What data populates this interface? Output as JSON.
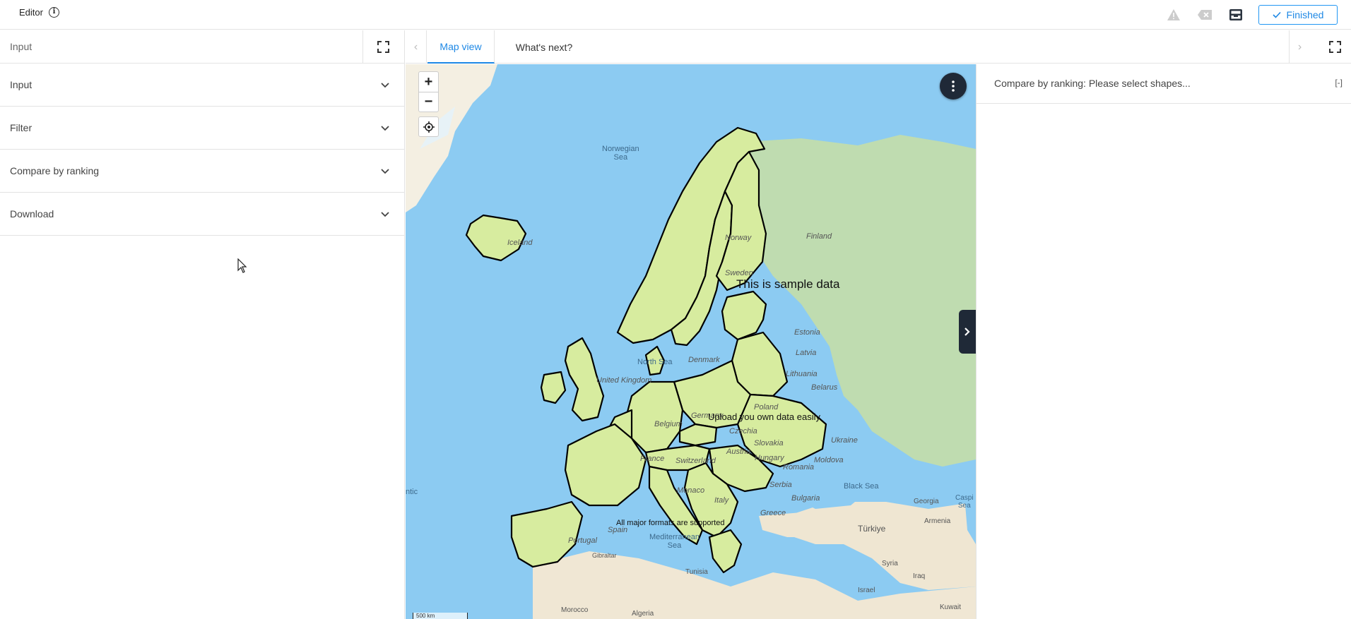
{
  "header": {
    "title": "Editor",
    "finished_label": "Finished",
    "colors": {
      "accent": "#1e88e5"
    },
    "icons": [
      "info-icon",
      "warning-icon",
      "delete-icon",
      "inbox-icon",
      "check-icon"
    ]
  },
  "left_panel": {
    "header_label": "Input",
    "sections": [
      {
        "label": "Input"
      },
      {
        "label": "Filter"
      },
      {
        "label": "Compare by ranking"
      },
      {
        "label": "Download"
      }
    ]
  },
  "tabs": {
    "map_view": "Map view",
    "whats_next": "What's next?"
  },
  "map": {
    "overlays": {
      "sample": "This is sample data",
      "upload": "Upload you own data easily",
      "formats": "All major formats are supported"
    },
    "labels": {
      "norwegian_sea": "Norwegian\nSea",
      "north_sea": "North Sea",
      "black_sea": "Black Sea",
      "mediterranean": "Mediterranean\nSea",
      "iceland": "Iceland",
      "finland": "Finland",
      "sweden": "Sweden",
      "norway": "Norway",
      "estonia": "Estonia",
      "latvia": "Latvia",
      "lithuania": "Lithuania",
      "belarus": "Belarus",
      "poland": "Poland",
      "ukraine": "Ukraine",
      "germany": "Germany",
      "czechia": "Czechia",
      "slovakia": "Slovakia",
      "austria": "Austria",
      "hungary": "Hungary",
      "romania": "Romania",
      "moldova": "Moldova",
      "france": "France",
      "switzerland": "Switzerland",
      "italy": "Italy",
      "spain": "Spain",
      "portugal": "Portugal",
      "belgium": "Belgium",
      "uk": "United Kingdom",
      "denmark": "Denmark",
      "serbia": "Serbia",
      "bulgaria": "Bulgaria",
      "monaco": "Monaco",
      "greece": "Greece",
      "turkiye": "Türkiye",
      "georgia": "Georgia",
      "armenia": "Armenia",
      "syria": "Syria",
      "iraq": "Iraq",
      "israel": "Israel",
      "kuwait": "Kuwait",
      "tunisia": "Tunisia",
      "algeria": "Algeria",
      "morocco": "Morocco",
      "atlantic": "ntic",
      "caspian": "Caspi\nSea",
      "gibraltar": "Gibraltar"
    },
    "scale": "500 km",
    "zoom_in": "+",
    "zoom_out": "−"
  },
  "right_panel": {
    "title": "Compare by ranking: Please select shapes...",
    "collapse_label": "[-]"
  }
}
